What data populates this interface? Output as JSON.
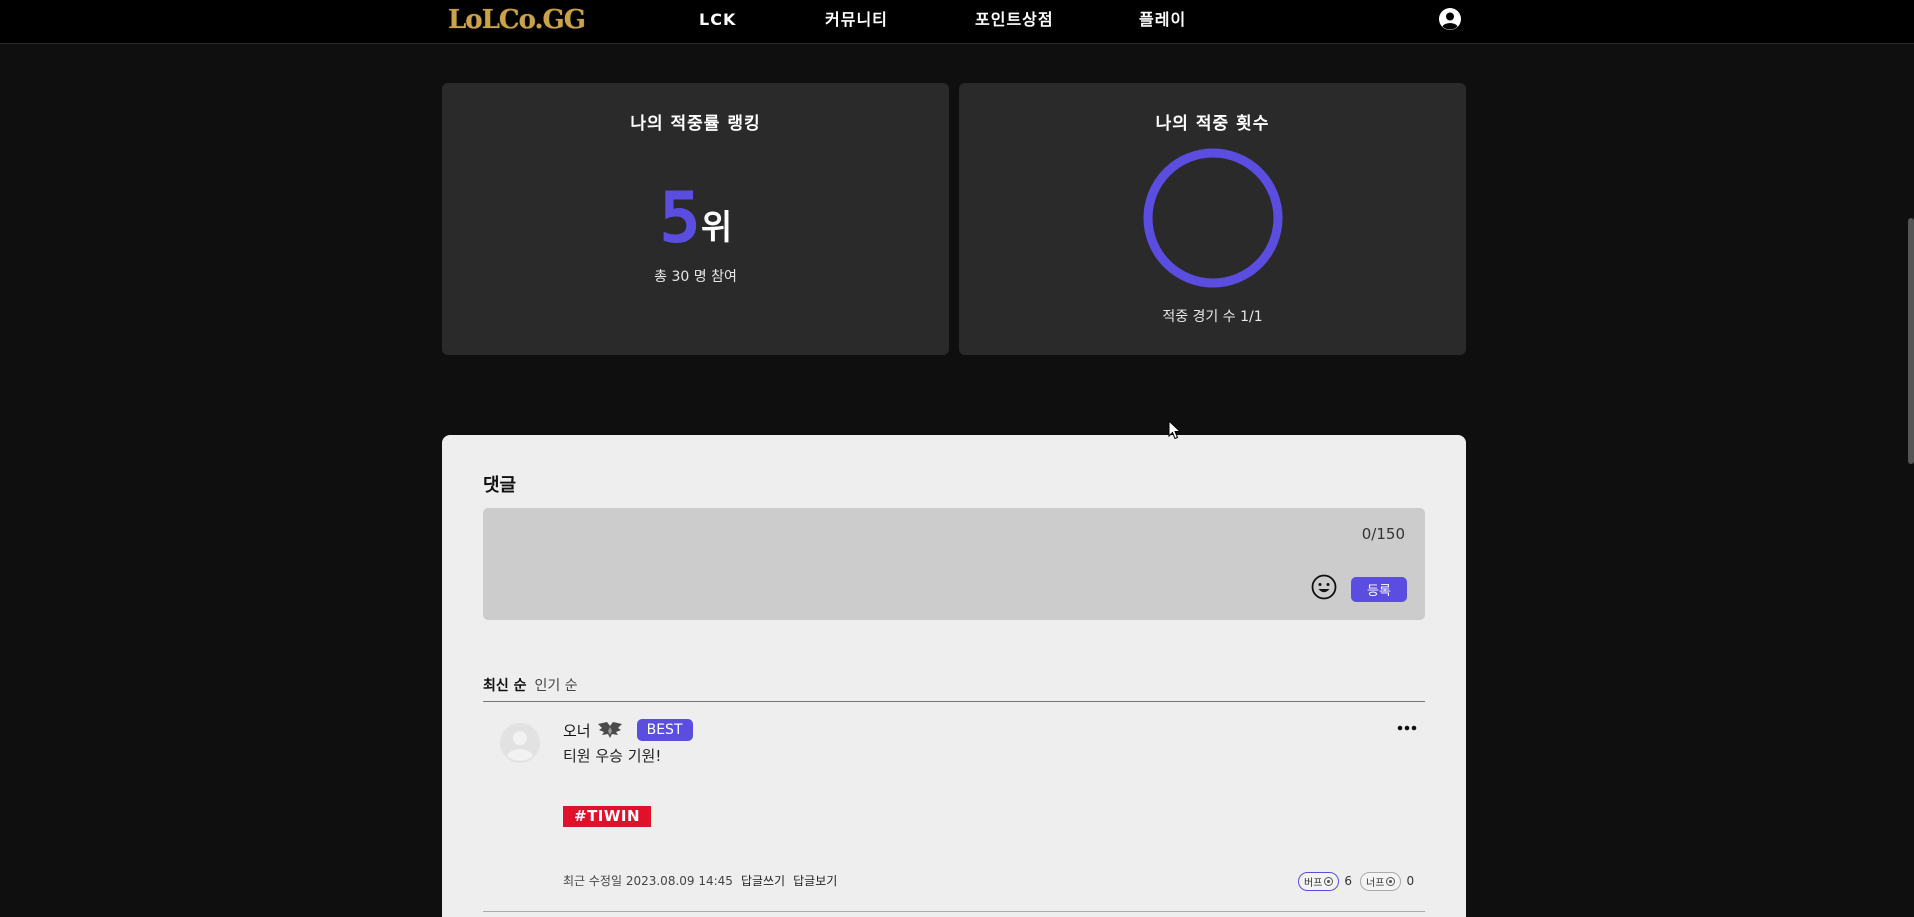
{
  "header": {
    "logo": "LoLCo.GG",
    "nav": [
      "LCK",
      "커뮤니티",
      "포인트상점",
      "플레이"
    ]
  },
  "ranking_card": {
    "title": "나의 적중률 랭킹",
    "rank": "5",
    "rank_unit": "위",
    "participants": "총 30 명 참여"
  },
  "hits_card": {
    "title": "나의 적중 횟수",
    "hit_fraction": 1.0,
    "summary": "적중 경기 수 1/1"
  },
  "comments": {
    "title": "댓글",
    "char_count": "0/150",
    "submit_label": "등록",
    "sort_latest": "최신 순",
    "sort_popular": "인기 순",
    "items": [
      {
        "author": "오너",
        "badge": "BEST",
        "text": "티원 우승 기원!",
        "hashtag": "#TIWIN",
        "edited": "최근 수정일 2023.08.09 14:45",
        "reply_write": "답글쓰기",
        "reply_view": "답글보기",
        "buff_label": "버프",
        "buff_count": "6",
        "nerf_label": "너프",
        "nerf_count": "0"
      }
    ]
  },
  "colors": {
    "accent": "#5b4de0",
    "hashtag_red": "#e0122b",
    "logo_gold": "#c9a24a"
  }
}
